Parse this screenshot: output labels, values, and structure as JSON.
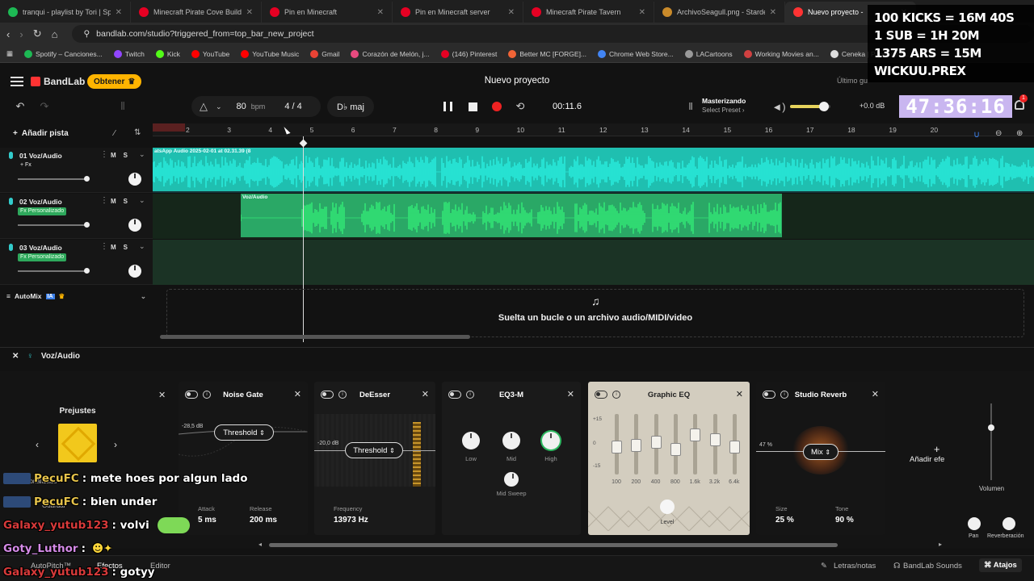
{
  "browser": {
    "tabs": [
      {
        "label": "tranqui - playlist by Tori | Spotify",
        "color": "#1db954",
        "active": false
      },
      {
        "label": "Minecraft Pirate Cove Build | Island /",
        "color": "#e60023",
        "active": false
      },
      {
        "label": "Pin en Minecraft",
        "color": "#e60023",
        "active": false
      },
      {
        "label": "Pin en Minecraft server",
        "color": "#e60023",
        "active": false
      },
      {
        "label": "Minecraft Pirate Tavern",
        "color": "#e60023",
        "active": false
      },
      {
        "label": "ArchivoSeagull.png - Stardew Valle",
        "color": "#c98a2a",
        "active": false
      },
      {
        "label": "Nuevo proyecto -",
        "color": "#f33",
        "active": true
      }
    ],
    "url": "bandlab.com/studio?triggered_from=top_bar_new_project",
    "bookmarks": [
      {
        "label": "Spotify – Canciones...",
        "color": "#1db954"
      },
      {
        "label": "Twitch",
        "color": "#9146ff"
      },
      {
        "label": "Kick",
        "color": "#53fc18"
      },
      {
        "label": "YouTube",
        "color": "#ff0000"
      },
      {
        "label": "YouTube Music",
        "color": "#ff0000"
      },
      {
        "label": "Gmail",
        "color": "#ea4335"
      },
      {
        "label": "Corazón de Melón, j...",
        "color": "#e84a7f"
      },
      {
        "label": "(146) Pinterest",
        "color": "#e60023"
      },
      {
        "label": "Better MC [FORGE]...",
        "color": "#f16436"
      },
      {
        "label": "Chrome Web Store...",
        "color": "#4285f4"
      },
      {
        "label": "LACartoons",
        "color": "#999999"
      },
      {
        "label": "Working Movies an...",
        "color": "#d04040"
      },
      {
        "label": "Ceneka | Panel de c...",
        "color": "#dddddd"
      }
    ]
  },
  "stream_overlay": {
    "lines": [
      "100 KICKS = 16M 40S",
      "1 SUB = 1H 20M",
      "1375 ARS = 15M",
      "WICKUU.PREX"
    ],
    "timer": "47:36:16",
    "notification_count": "1"
  },
  "app": {
    "brand": "BandLab",
    "upgrade_label": "Obtener",
    "project_title": "Nuevo proyecto",
    "save_status": "Último gu"
  },
  "transport": {
    "bpm": "80",
    "bpm_unit": "bpm",
    "time_signature": "4 / 4",
    "key": "D♭ maj",
    "time": "00:11.6",
    "mastering_title": "Masterizando",
    "mastering_preset": "Select Preset",
    "master_db": "+0.0 dB",
    "master_volume": 0.82
  },
  "timeline": {
    "add_track_label": "Añadir pista",
    "ruler_ticks": [
      "2",
      "3",
      "4",
      "5",
      "6",
      "7",
      "8",
      "9",
      "10",
      "11",
      "12",
      "13",
      "14",
      "15",
      "16",
      "17",
      "18",
      "19",
      "20"
    ],
    "tracks": [
      {
        "name": "01  Voz/Audio",
        "fx": "+ Fx",
        "fx_style": "plain",
        "clip_label": "atsApp Audio 2025-02-01 at 02.31.39 (8",
        "clip_color": "#1fbfb0",
        "wave_color": "#2af0e0"
      },
      {
        "name": "02  Voz/Audio",
        "fx": "Fx Personalizado",
        "fx_style": "green",
        "clip_label": "Voz/Audio",
        "clip_color": "#2aa866",
        "wave_color": "#33ee77"
      },
      {
        "name": "03  Voz/Audio",
        "fx": "Fx Personalizado",
        "fx_style": "green",
        "clip_label": "",
        "clip_color": "",
        "wave_color": ""
      }
    ],
    "track_buttons": "MS",
    "automix_label": "AutoMix",
    "automix_badge": "IA",
    "drop_text": "Suelta un bucle o un archivo audio/MIDI/video"
  },
  "effects": {
    "header_label": "Voz/Audio",
    "presets_label": "Prejustes",
    "chain": [
      {
        "title": "Noise Gate",
        "param_button": "Threshold",
        "db_label": "-28,5 dB",
        "params": [
          {
            "label": "Attack",
            "value": "5 ms"
          },
          {
            "label": "Release",
            "value": "200 ms"
          }
        ]
      },
      {
        "title": "DeEsser",
        "param_button": "Threshold",
        "db_label": "-20,0 dB",
        "params": [
          {
            "label": "Frequency",
            "value": "13973 Hz"
          }
        ]
      },
      {
        "title": "EQ3-M",
        "knobs": [
          "Low",
          "Mid",
          "High"
        ],
        "extra_knob": "Mid Sweep"
      },
      {
        "title": "Graphic EQ",
        "scale": [
          "+15",
          "0",
          "-15"
        ],
        "bands": [
          "100",
          "200",
          "400",
          "800",
          "1.6k",
          "3.2k",
          "6.4k"
        ],
        "band_levels": [
          0.55,
          0.52,
          0.47,
          0.58,
          0.35,
          0.42,
          0.55
        ],
        "level_label": "Level"
      },
      {
        "title": "Studio Reverb",
        "param_button": "Mix",
        "mix_label": "47 %",
        "params": [
          {
            "label": "Size",
            "value": "25 %"
          },
          {
            "label": "Tone",
            "value": "90 %"
          }
        ]
      }
    ],
    "add_effect_label": "Añadir efe",
    "volume_label": "Volumen",
    "pan_label": "Pan",
    "reverb_label": "Reverberación"
  },
  "bottom_bar": {
    "items": [
      "AutoPitch™",
      "Efectos",
      "Editor",
      "Letras/notas",
      "BandLab Sounds",
      "Atajos"
    ]
  },
  "chat": {
    "messages": [
      {
        "user": "PecuFC",
        "user_color": "#e6c34a",
        "text": ": mete hoes por algun lado"
      },
      {
        "user": "PecuFC",
        "user_color": "#e6c34a",
        "text": ": bien under"
      },
      {
        "user": "Galaxy_yutub123",
        "user_color": "#d83a3a",
        "text": ": volvi"
      },
      {
        "user": "Goty_Luthor",
        "user_color": "#d48ae6",
        "text": ":"
      },
      {
        "user": "Galaxy_yutub123",
        "user_color": "#d83a3a",
        "text": ":        gotyy"
      }
    ],
    "underlay_labels": [
      "Personalizado",
      "Guardar"
    ]
  }
}
